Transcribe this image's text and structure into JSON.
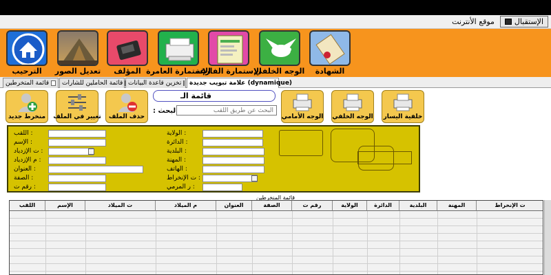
{
  "menu": {
    "items": [
      {
        "label": "الإستقبال",
        "active": true
      },
      {
        "label": "موقع الأنترنت",
        "active": false
      }
    ]
  },
  "ribbon": {
    "buttons": [
      {
        "label": "الشهادة",
        "icon": "scroll-certificate-icon"
      },
      {
        "label": "الوجه الخلفي",
        "icon": "dove-icon"
      },
      {
        "label": "الإستمارة الفارغة",
        "icon": "blank-form-icon"
      },
      {
        "label": "الإستمارة العامرة",
        "icon": "printer-icon"
      },
      {
        "label": "المؤلف",
        "icon": "author-device-icon"
      },
      {
        "label": "تعديل الصور",
        "icon": "photo-landscape-icon"
      },
      {
        "label": "الترحيب",
        "icon": "home-icon"
      }
    ]
  },
  "tabs": [
    {
      "label": "علامة تبويب جديدة (dynamique)",
      "active": true
    },
    {
      "label": "تخزين قاعدة البيانات",
      "active": false
    },
    {
      "label": "قائمة الحاملين للشارات",
      "active": false
    },
    {
      "label": "قائمة المتخرطين",
      "active": false
    }
  ],
  "actions": {
    "right": [
      {
        "label": "خلفية اليسار",
        "icon": "printer-icon"
      },
      {
        "label": "الوجه الخلفي",
        "icon": "printer-icon"
      },
      {
        "label": "الوجه الأمامي",
        "icon": "printer-icon"
      }
    ],
    "left": [
      {
        "label": "حذف الملف",
        "icon": "remove-user-icon"
      },
      {
        "label": "تغيير في الملف",
        "icon": "sliders-icon"
      },
      {
        "label": "منخرط جديد",
        "icon": "add-user-icon"
      }
    ]
  },
  "form": {
    "title": "قائمة الـ",
    "search_label": ": البحث",
    "search_placeholder": "البحث عن طريق اللقب",
    "left_labels": [
      ": اللقب",
      ": الإسم",
      ": ت الإزدياد",
      ": م الإزدياد",
      ": العنوان",
      ": الصفة",
      ": رقم ت"
    ],
    "right_labels": [
      ": الولاية",
      ": الدائرة",
      ": البلدية",
      ": المهنة",
      ": الهاتف",
      ": ت الإنخراط",
      ": ر المرمي"
    ]
  },
  "table": {
    "caption": "قائمة المنخرطين",
    "columns": [
      "ت الإنخراط",
      "المهنة",
      "البلدية",
      "الدائرة",
      "الولاية",
      "رقم ت",
      "الصفة",
      "العنوان",
      "م الميلاد",
      "ت الميلاد",
      "الإسم",
      "اللقب"
    ]
  },
  "colors": {
    "ribbon": "#f7941d",
    "panel": "#d6c200",
    "action_button": "#f4c84e"
  }
}
